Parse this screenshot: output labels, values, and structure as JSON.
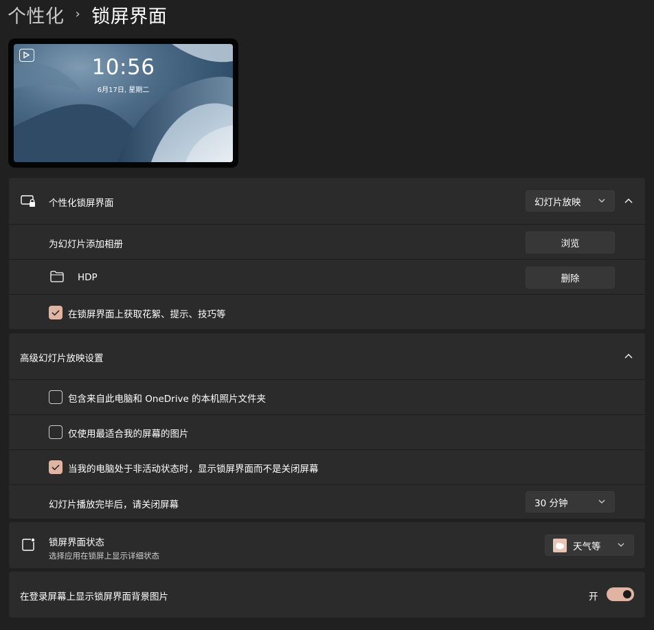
{
  "breadcrumb": {
    "parent": "个性化",
    "separator": "›",
    "current": "锁屏界面"
  },
  "preview": {
    "time": "10:56",
    "date": "6月17日, 星期二"
  },
  "lock_screen": {
    "title": "个性化锁屏界面",
    "mode_value": "幻灯片放映",
    "add_album_label": "为幻灯片添加相册",
    "browse_button": "浏览",
    "folder_name": "HDP",
    "remove_button": "删除",
    "fun_facts_label": "在锁屏界面上获取花絮、提示、技巧等",
    "fun_facts_checked": true
  },
  "advanced": {
    "title": "高级幻灯片放映设置",
    "options": [
      {
        "label": "包含来自此电脑和 OneDrive 的本机照片文件夹",
        "checked": false
      },
      {
        "label": "仅使用最适合我的屏幕的图片",
        "checked": false
      },
      {
        "label": "当我的电脑处于非活动状态时，显示锁屏界面而不是关闭屏幕",
        "checked": true
      }
    ],
    "turn_off_label": "幻灯片播放完毕后，请关闭屏幕",
    "turn_off_value": "30 分钟"
  },
  "status": {
    "title": "锁屏界面状态",
    "subtitle": "选择应用在锁屏上显示详细状态",
    "value": "天气等"
  },
  "signin": {
    "label": "在登录屏幕上显示锁屏界面背景图片",
    "toggle_text": "开",
    "on": true
  },
  "colors": {
    "accent": "#e0b3a3",
    "background": "#202020",
    "card": "#2b2b2b"
  }
}
